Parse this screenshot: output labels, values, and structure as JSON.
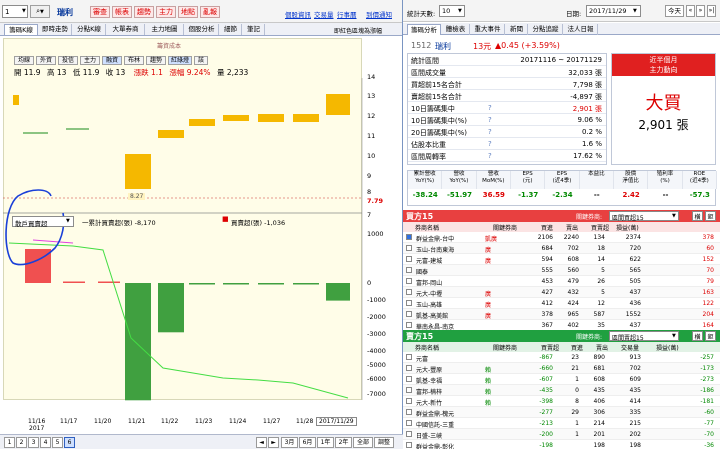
{
  "toolbar_left": {
    "code_value": "1",
    "stock_name": "瑞利",
    "buttons": [
      "審查",
      "帳表",
      "趨勢",
      "主力",
      "地點",
      "亂報"
    ],
    "links": [
      "個股資訊",
      "交易量",
      "行事曆",
      "到價通知"
    ]
  },
  "main_tabs": [
    "籌碼K線",
    "即時走勢",
    "分點K線",
    "大單券商",
    "主力地圖",
    "個股分析",
    "細節",
    "筆記"
  ],
  "main_tabs_right": "即紅色區塊為漲幅",
  "chart_legend_top": "籌資成本",
  "indicator_buttons": [
    "均線",
    "外資",
    "投信",
    "主力",
    "融資",
    "布林",
    "趨勢",
    "紅綠燈",
    "該"
  ],
  "ohlc": {
    "open": "開 11.9",
    "high": "高 13",
    "low": "低 11.9",
    "close": "收 13",
    "chg": "漲跌 1.1",
    "pct": "漲幅 9.24%",
    "vol": "量 2,233"
  },
  "price_axis": [
    "14",
    "13",
    "12",
    "11",
    "10",
    "9",
    "8",
    "7.79",
    "7"
  ],
  "lower_axis": [
    "1000",
    "0",
    "-1000",
    "-2000",
    "-3000",
    "-4000",
    "-5000",
    "-6000",
    "-7000"
  ],
  "lower_select": "散戶買賣超",
  "lower_legend": {
    "l1": "一累計買賣超(張) -8,170",
    "l2": "買賣超(張) -1,036"
  },
  "low_tag": "8.27",
  "x_dates": [
    "11/16\n2017",
    "11/17",
    "11/20",
    "11/21",
    "11/22",
    "11/23",
    "11/24",
    "11/27",
    "11/28",
    "2017/11/29"
  ],
  "cursor_date": "2017/11/29",
  "bottom_bar": {
    "nums": [
      "1",
      "2",
      "3",
      "4",
      "5",
      "6"
    ],
    "periods": [
      "3月",
      "6月",
      "1年",
      "2年",
      "全部",
      "調整"
    ]
  },
  "chart_data": {
    "type": "bar",
    "categories": [
      "11/16",
      "11/17",
      "11/20",
      "11/21",
      "11/22",
      "11/23",
      "11/24",
      "11/27",
      "11/28",
      "11/29"
    ],
    "series": [
      {
        "name": "買賣超(張)",
        "values": [
          2000,
          50,
          20,
          -6900,
          -2900,
          -80,
          -50,
          -40,
          -60,
          -1036
        ]
      }
    ]
  },
  "right_top": {
    "label": "統計天數:",
    "days": "10",
    "date_label": "日期:",
    "date": "2017/11/29",
    "today": "今天"
  },
  "right_tabs": [
    "籌碼分析",
    "體檢表",
    "重大事件",
    "新聞",
    "分點追蹤",
    "法人日報"
  ],
  "summary": {
    "code": "1512",
    "name": "瑞利",
    "price": "13元",
    "chg": "▲0.45 (+3.59%)",
    "rows": [
      [
        "統計區間",
        "20171116 ~ 20171129"
      ],
      [
        "區間成交量",
        "32,033 張"
      ],
      [
        "買超前15名合計",
        "7,798 張"
      ],
      [
        "賣超前15名合計",
        "-4,897 張"
      ],
      [
        "10日籌碼集中",
        "2,901 張"
      ],
      [
        "10日籌碼集中(%)",
        "9.06 %"
      ],
      [
        "20日籌碼集中(%)",
        "0.2 %"
      ],
      [
        "佔股本比重",
        "1.6 %"
      ],
      [
        "區間周轉率",
        "17.62 %"
      ]
    ],
    "box_title1": "近半個月",
    "box_title2": "主力動向",
    "box_big": "大買",
    "box_val": "2,901 張"
  },
  "fin": {
    "headers": [
      "累計營收\nYoY(%)",
      "營收\nYoY(%)",
      "營收\nMoM(%)",
      "EPS\n(元)",
      "EPS\n(近4季)",
      "本益比",
      "股價\n淨值比",
      "殖利率\n(%)",
      "ROE\n(近4季)"
    ],
    "values": [
      "-38.24",
      "-51.97",
      "36.59",
      "-1.37",
      "-2.34",
      "--",
      "2.42",
      "--",
      "-57.3"
    ]
  },
  "buy": {
    "title": "買方15",
    "rel_label": "關鍵券商:",
    "rel_value": "區間買超15",
    "btn1": "横",
    "btn2": "鉅",
    "headers": [
      "券商名稱",
      "關鍵券商",
      "買進",
      "賣出",
      "買賣超",
      "損益(萬)"
    ],
    "rows": [
      [
        "群益金鼎-台中",
        "凱廣",
        "2106",
        "2240",
        "134",
        "2374",
        "378"
      ],
      [
        "玉山-台南東海",
        "廣",
        "684",
        "702",
        "18",
        "720",
        "60"
      ],
      [
        "元富-建城",
        "廣",
        "594",
        "608",
        "14",
        "622",
        "152"
      ],
      [
        "國泰",
        "",
        "555",
        "560",
        "5",
        "565",
        "70"
      ],
      [
        "富邦-岡山",
        "",
        "453",
        "479",
        "26",
        "505",
        "79"
      ],
      [
        "元大-中壢",
        "廣",
        "427",
        "432",
        "5",
        "437",
        "163"
      ],
      [
        "玉山-高雄",
        "廣",
        "412",
        "424",
        "12",
        "436",
        "122"
      ],
      [
        "凱基-高美館",
        "廣",
        "378",
        "965",
        "587",
        "1552",
        "204"
      ],
      [
        "華南永昌-南京",
        "",
        "367",
        "402",
        "35",
        "437",
        "164"
      ]
    ]
  },
  "sell": {
    "title": "賣方15",
    "rel_label": "關鍵券商:",
    "rel_value": "區間賣超15",
    "btn1": "横",
    "btn2": "鉅",
    "headers": [
      "券商名稱",
      "關鍵券商",
      "買賣超",
      "買進",
      "賣出",
      "交易量",
      "損益(萬)"
    ],
    "rows": [
      [
        "元富",
        "",
        "-867",
        "23",
        "890",
        "913",
        "-257"
      ],
      [
        "元大-豐原",
        "賴",
        "-660",
        "21",
        "681",
        "702",
        "-173"
      ],
      [
        "凱基-幸福",
        "賴",
        "-607",
        "1",
        "608",
        "609",
        "-273"
      ],
      [
        "富邦-楠梓",
        "賴",
        "-435",
        "0",
        "435",
        "435",
        "-186"
      ],
      [
        "元大-新竹",
        "賴",
        "-398",
        "8",
        "406",
        "414",
        "-181"
      ],
      [
        "群益金鼎-槐元",
        "",
        "-277",
        "29",
        "306",
        "335",
        "-60"
      ],
      [
        "中國信託-三重",
        "",
        "-213",
        "1",
        "214",
        "215",
        "-77"
      ],
      [
        "日盛-三峽",
        "",
        "-200",
        "1",
        "201",
        "202",
        "-70"
      ],
      [
        "群益金鼎-彰化",
        "",
        "-198",
        "",
        "198",
        "198",
        "-36"
      ]
    ]
  }
}
